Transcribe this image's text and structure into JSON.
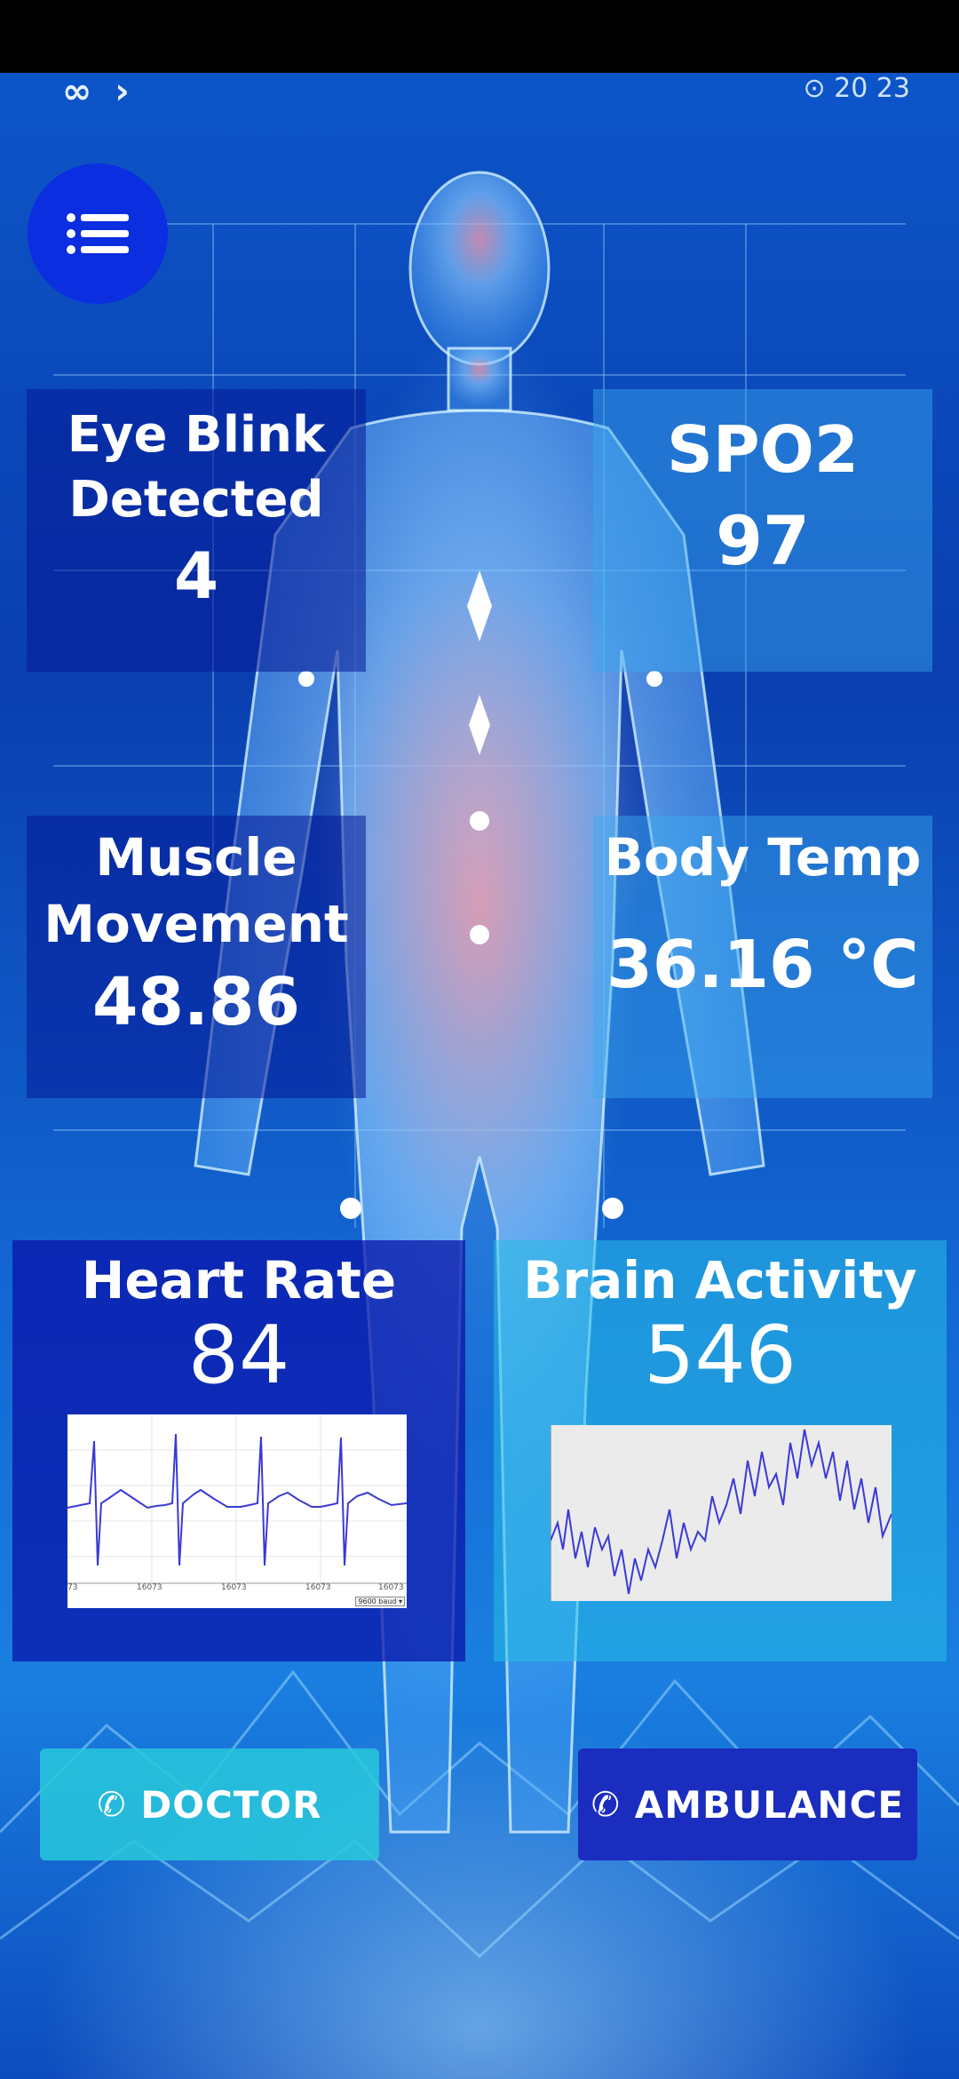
{
  "status_bar": {
    "left_icons": "∞ ›",
    "right_text": "⊙ 20 23"
  },
  "menu": {
    "icon": "list-icon"
  },
  "cards": {
    "eye_blink": {
      "title_line1": "Eye Blink",
      "title_line2": "Detected",
      "value": "4"
    },
    "spo2": {
      "title": "SPO2",
      "value": "97"
    },
    "muscle": {
      "title_line1": "Muscle",
      "title_line2": "Movement",
      "value": "48.86"
    },
    "body_temp": {
      "title": "Body Temp",
      "value": "36.16 °C"
    },
    "heart_rate": {
      "title": "Heart Rate",
      "value": "84",
      "tick_labels": [
        "73",
        "16073",
        "16073",
        "16073",
        "16073"
      ],
      "dropdown": "9600 baud"
    },
    "brain": {
      "title": "Brain Activity",
      "value": "546"
    }
  },
  "buttons": {
    "doctor": {
      "label": "DOCTOR",
      "icon": "phone-icon"
    },
    "ambulance": {
      "label": "AMBULANCE",
      "icon": "phone-icon"
    }
  },
  "colors": {
    "menu_button": "#0b2ee0",
    "doctor_button": "#28c8dc",
    "ambulance_button": "#1a2dbf"
  }
}
